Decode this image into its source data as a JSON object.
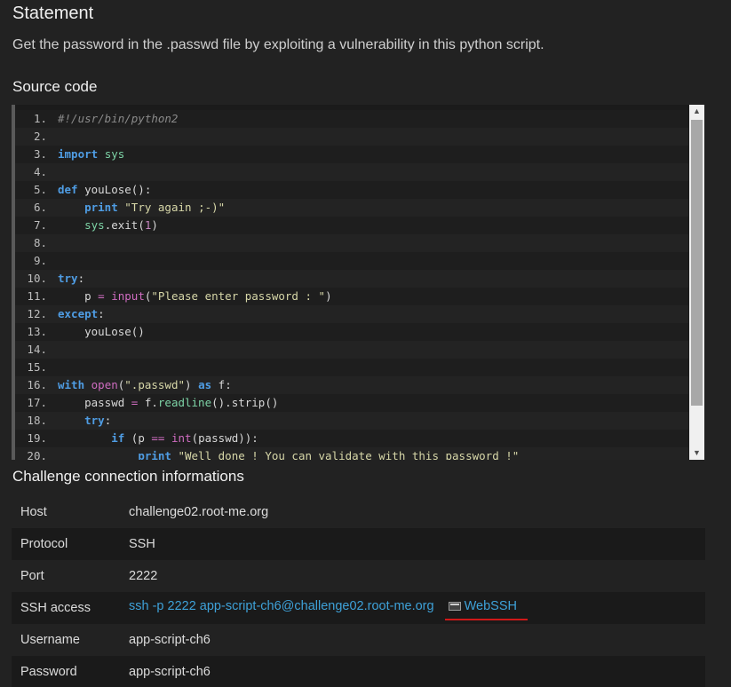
{
  "statement": {
    "title": "Statement",
    "text": "Get the password in the .passwd file by exploiting a vulnerability in this python script."
  },
  "source": {
    "title": "Source code",
    "lines": [
      {
        "n": "1.",
        "tokens": [
          {
            "t": "#!/usr/bin/python2",
            "c": "cm"
          }
        ]
      },
      {
        "n": "2.",
        "tokens": []
      },
      {
        "n": "3.",
        "tokens": [
          {
            "t": "import",
            "c": "kw"
          },
          {
            "t": " "
          },
          {
            "t": "sys",
            "c": "mod"
          }
        ]
      },
      {
        "n": "4.",
        "tokens": []
      },
      {
        "n": "5.",
        "tokens": [
          {
            "t": "def",
            "c": "kw"
          },
          {
            "t": " youLose():"
          }
        ]
      },
      {
        "n": "6.",
        "tokens": [
          {
            "t": "    "
          },
          {
            "t": "print",
            "c": "kw"
          },
          {
            "t": " "
          },
          {
            "t": "\"Try again ;-)\"",
            "c": "str"
          }
        ]
      },
      {
        "n": "7.",
        "tokens": [
          {
            "t": "    "
          },
          {
            "t": "sys",
            "c": "mod"
          },
          {
            "t": ".exit("
          },
          {
            "t": "1",
            "c": "num"
          },
          {
            "t": ")"
          }
        ]
      },
      {
        "n": "8.",
        "tokens": []
      },
      {
        "n": "9.",
        "tokens": []
      },
      {
        "n": "10.",
        "tokens": [
          {
            "t": "try",
            "c": "kw"
          },
          {
            "t": ":"
          }
        ]
      },
      {
        "n": "11.",
        "tokens": [
          {
            "t": "    p "
          },
          {
            "t": "=",
            "c": "op"
          },
          {
            "t": " "
          },
          {
            "t": "input",
            "c": "fn"
          },
          {
            "t": "("
          },
          {
            "t": "\"Please enter password : \"",
            "c": "str"
          },
          {
            "t": ")"
          }
        ]
      },
      {
        "n": "12.",
        "tokens": [
          {
            "t": "except",
            "c": "kw"
          },
          {
            "t": ":"
          }
        ]
      },
      {
        "n": "13.",
        "tokens": [
          {
            "t": "    youLose()"
          }
        ]
      },
      {
        "n": "14.",
        "tokens": []
      },
      {
        "n": "15.",
        "tokens": []
      },
      {
        "n": "16.",
        "tokens": [
          {
            "t": "with",
            "c": "kw"
          },
          {
            "t": " "
          },
          {
            "t": "open",
            "c": "fn"
          },
          {
            "t": "("
          },
          {
            "t": "\".passwd\"",
            "c": "str"
          },
          {
            "t": ") "
          },
          {
            "t": "as",
            "c": "kw"
          },
          {
            "t": " f:"
          }
        ]
      },
      {
        "n": "17.",
        "tokens": [
          {
            "t": "    passwd "
          },
          {
            "t": "=",
            "c": "op"
          },
          {
            "t": " f."
          },
          {
            "t": "readline",
            "c": "call"
          },
          {
            "t": "().strip()"
          }
        ]
      },
      {
        "n": "18.",
        "tokens": [
          {
            "t": "    "
          },
          {
            "t": "try",
            "c": "kw"
          },
          {
            "t": ":"
          }
        ]
      },
      {
        "n": "19.",
        "tokens": [
          {
            "t": "        "
          },
          {
            "t": "if",
            "c": "kw"
          },
          {
            "t": " (p "
          },
          {
            "t": "==",
            "c": "op"
          },
          {
            "t": " "
          },
          {
            "t": "int",
            "c": "fn"
          },
          {
            "t": "(passwd)):"
          }
        ]
      },
      {
        "n": "20.",
        "tokens": [
          {
            "t": "            "
          },
          {
            "t": "print",
            "c": "kw"
          },
          {
            "t": " "
          },
          {
            "t": "\"Well done ! You can validate with this password !\"",
            "c": "str"
          }
        ]
      }
    ]
  },
  "connection": {
    "title": "Challenge connection informations",
    "rows": [
      {
        "label": "Host",
        "value": "challenge02.root-me.org"
      },
      {
        "label": "Protocol",
        "value": "SSH"
      },
      {
        "label": "Port",
        "value": "2222"
      },
      {
        "label": "SSH access",
        "value": "ssh -p 2222 app-script-ch6@challenge02.root-me.org",
        "link": true,
        "extra": "WebSSH"
      },
      {
        "label": "Username",
        "value": "app-script-ch6"
      },
      {
        "label": "Password",
        "value": "app-script-ch6"
      }
    ]
  },
  "icons": {
    "scroll_up": "triangle-up-icon",
    "scroll_down": "triangle-down-icon",
    "webssh": "terminal-icon"
  },
  "colors": {
    "background": "#222222",
    "link": "#3ea1d8",
    "keyword": "#4f9de4",
    "highlight_underline": "#d01818"
  }
}
